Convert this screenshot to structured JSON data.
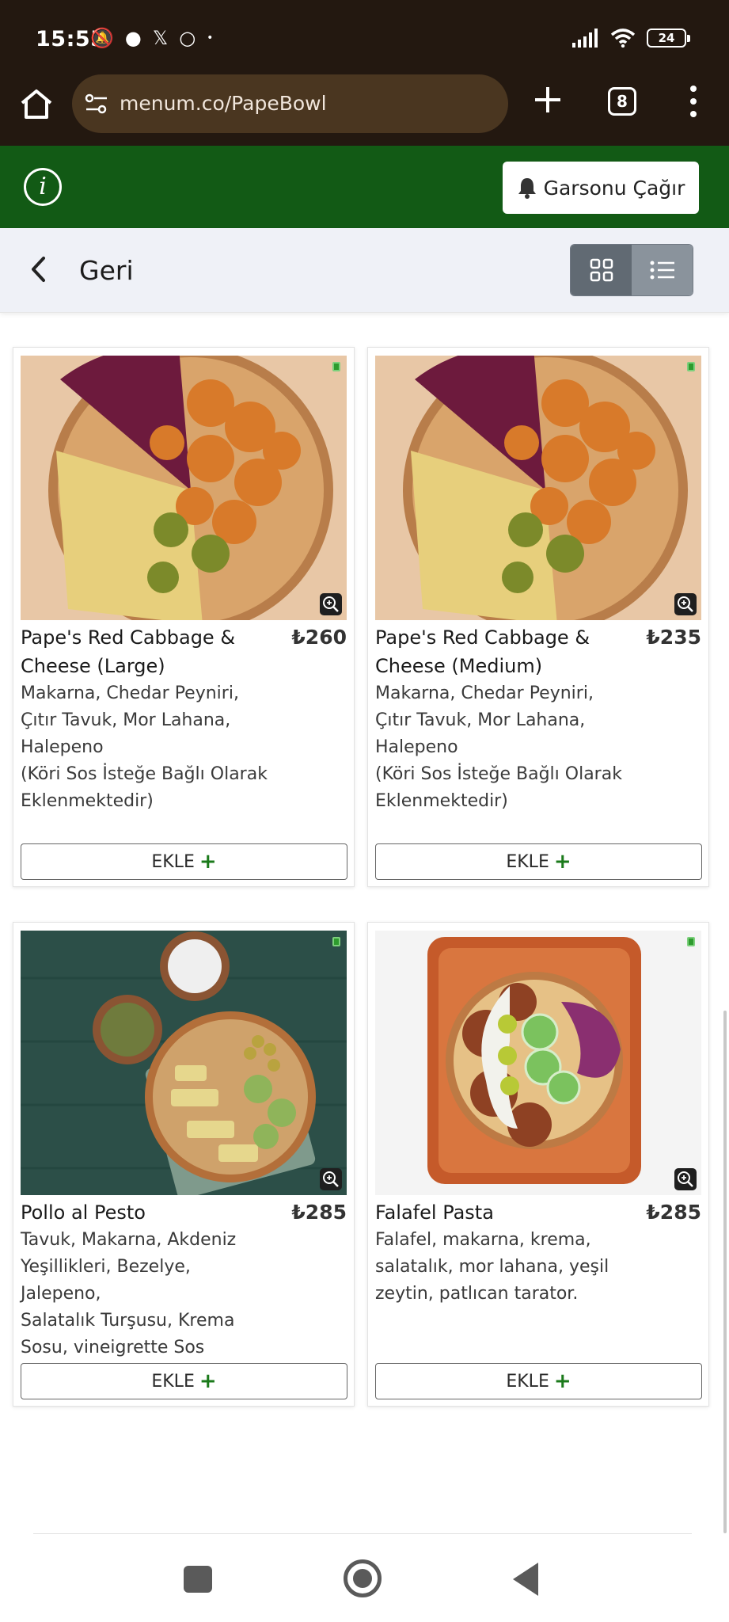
{
  "status_bar": {
    "time": "15:55",
    "left_icons": [
      "mute-bell-icon",
      "chat-icon",
      "x-logo-icon",
      "loop-icon",
      "dot-icon"
    ],
    "battery": "24"
  },
  "browser": {
    "url": "menum.co/PapeBowl",
    "tab_count": "8"
  },
  "header": {
    "call_waiter_label": "Garsonu Çağır"
  },
  "nav": {
    "back_label": "Geri",
    "view_mode": "grid"
  },
  "products": [
    {
      "title": "Pape's Red Cabbage & Cheese (Large)",
      "price": "₺260",
      "description": "Makarna, Chedar Peyniri,\nÇıtır Tavuk, Mor Lahana,\nHalepeno\n(Köri Sos İsteğe Bağlı Olarak\nEklenmektedir)",
      "add_label": "EKLE",
      "image": "pasta-bowl-chicken-cabbage"
    },
    {
      "title": "Pape's Red Cabbage & Cheese (Medium)",
      "price": "₺235",
      "description": "Makarna, Chedar Peyniri,\nÇıtır Tavuk, Mor Lahana,\nHalepeno\n(Köri Sos İsteğe Bağlı Olarak\nEklenmektedir)",
      "add_label": "EKLE",
      "image": "pasta-bowl-chicken-cabbage"
    },
    {
      "title": "Pollo al Pesto",
      "price": "₺285",
      "description": "Tavuk, Makarna, Akdeniz\nYeşillikleri, Bezelye, Jalepeno,\nSalatalık Turşusu, Krema\nSosu, vineigrette Sos",
      "add_label": "EKLE",
      "image": "pesto-bowl-green-table"
    },
    {
      "title": "Falafel Pasta",
      "price": "₺285",
      "description": "Falafel, makarna, krema,\nsalatalık, mor lahana, yeşil\nzeytin, patlıcan tarator.",
      "add_label": "EKLE",
      "image": "falafel-bowl-orange-tray"
    }
  ],
  "colors": {
    "status_bg": "#231810",
    "header_green": "#125a15",
    "nav_bg": "#eff1f7"
  }
}
